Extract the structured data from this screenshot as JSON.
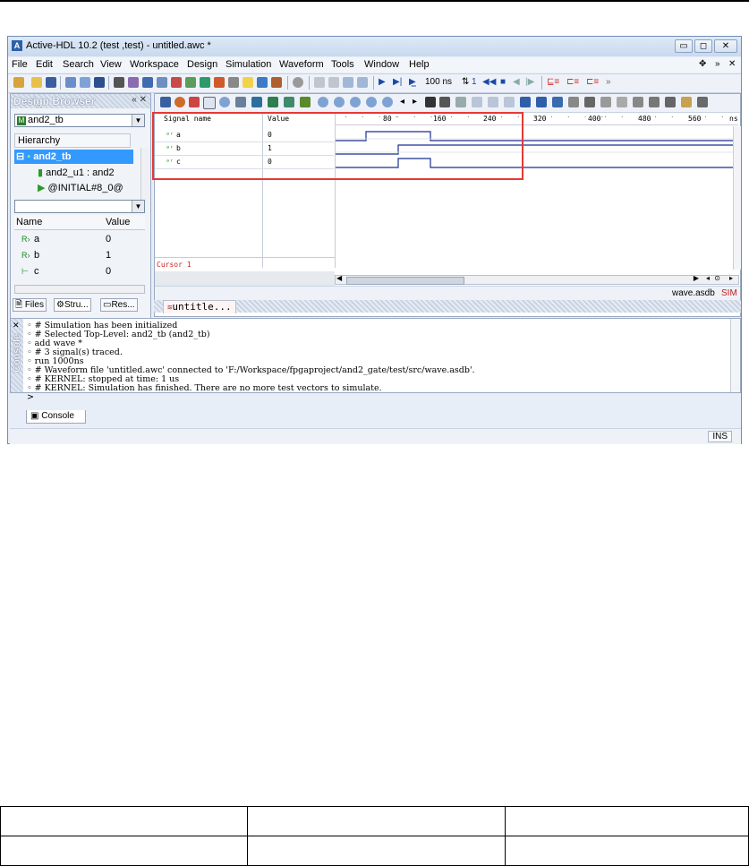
{
  "window": {
    "title": "Active-HDL 10.2 (test ,test) - untitled.awc *",
    "app_icon_letter": "A"
  },
  "menu": [
    "File",
    "Edit",
    "Search",
    "View",
    "Workspace",
    "Design",
    "Simulation",
    "Waveform",
    "Tools",
    "Window",
    "Help"
  ],
  "toolbar": {
    "time_step": "100 ns"
  },
  "design_browser": {
    "title": "Design Browser",
    "top_selector": "and2_tb",
    "hierarchy_label": "Hierarchy",
    "tree": [
      {
        "label": "and2_tb",
        "selected": true
      },
      {
        "label": "and2_u1 : and2"
      },
      {
        "label": "@INITIAL#8_0@"
      }
    ],
    "list_headers": {
      "name": "Name",
      "value": "Value"
    },
    "signals": [
      {
        "name": "a",
        "value": "0"
      },
      {
        "name": "b",
        "value": "1"
      },
      {
        "name": "c",
        "value": "0"
      }
    ],
    "tabs": [
      "Files",
      "Stru...",
      "Res..."
    ]
  },
  "waveform": {
    "header_signal": "Signal name",
    "header_value": "Value",
    "ticks": [
      "80",
      "160",
      "240",
      "320",
      "400",
      "480",
      "560",
      "ns"
    ],
    "signals": [
      {
        "name": "a",
        "value": "0"
      },
      {
        "name": "b",
        "value": "1"
      },
      {
        "name": "c",
        "value": "0"
      }
    ],
    "cursor_label": "Cursor 1",
    "file_label": "wave.asdb",
    "sim_label": "SIM",
    "doc_tab": "untitle..."
  },
  "console": {
    "lines": [
      "#  Simulation has been initialized",
      "#  Selected Top-Level: and2_tb (and2_tb)",
      "add wave *",
      "# 3 signal(s) traced.",
      "run 1000ns",
      "# Waveform file 'untitled.awc' connected to 'F:/Workspace/fpgaproject/and2_gate/test/src/wave.asdb'.",
      "# KERNEL: stopped at time: 1 us",
      "# KERNEL: Simulation has finished. There are no more test vectors to simulate.",
      ">"
    ],
    "side_label": "Console",
    "tab_label": "Console"
  },
  "status": {
    "ins": "INS"
  }
}
